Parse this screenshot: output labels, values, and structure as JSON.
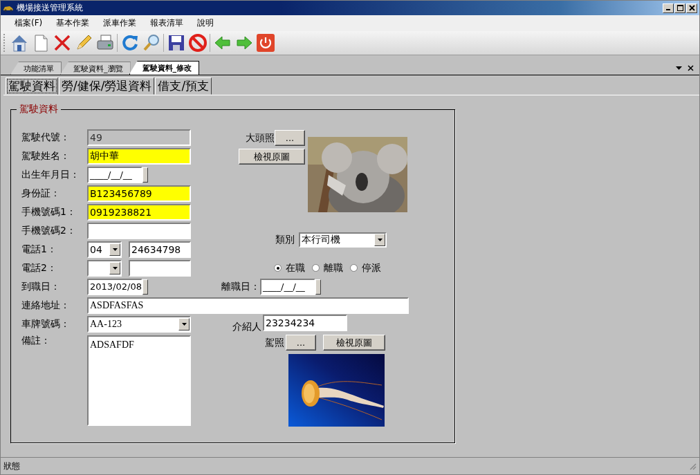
{
  "window": {
    "title": "機場接送管理系統"
  },
  "menu": [
    "檔案(F)",
    "基本作業",
    "派車作業",
    "報表清單",
    "說明"
  ],
  "doc_tabs": [
    {
      "label": "功能清單",
      "selected": false
    },
    {
      "label": "駕駛資料_瀏覽",
      "selected": false
    },
    {
      "label": "駕駛資料_修改",
      "selected": true
    }
  ],
  "sub_tabs": [
    {
      "label": "駕駛資料",
      "selected": true
    },
    {
      "label": "勞/健保/勞退資料",
      "selected": false
    },
    {
      "label": "借支/預支",
      "selected": false
    }
  ],
  "group": {
    "title": "駕駛資料"
  },
  "left_fields": [
    {
      "label": "駕駛代號：",
      "kind": "readonly",
      "value": "49"
    },
    {
      "label": "駕駛姓名：",
      "kind": "required",
      "value": "胡中華"
    },
    {
      "label": "出生年月日：",
      "kind": "date",
      "value": "____/__/__"
    },
    {
      "label": "身份証：",
      "kind": "required",
      "value": "B123456789"
    },
    {
      "label": "手機號碼1：",
      "kind": "required",
      "value": "0919238821"
    },
    {
      "label": "手機號碼2：",
      "kind": "text"
    },
    {
      "label": "電話1：",
      "kind": "phone",
      "area": "04",
      "number": "24634798"
    },
    {
      "label": "電話2：",
      "kind": "phone"
    },
    {
      "label": "到職日：",
      "kind": "date",
      "value": "2013/02/08"
    }
  ],
  "address": {
    "label": "連絡地址：",
    "value": "ASDFASFAS"
  },
  "plate": {
    "label": "車牌號碼：",
    "value": "AA-123"
  },
  "remark": {
    "label": "備註：",
    "value": "ADSAFDF"
  },
  "photo": {
    "label": "大頭照",
    "browse": "...",
    "view": "檢視原圖"
  },
  "category": {
    "label": "類別",
    "value": "本行司機"
  },
  "status_options": [
    {
      "label": "在職",
      "selected": true
    },
    {
      "label": "離職",
      "selected": false
    },
    {
      "label": "停派",
      "selected": false
    }
  ],
  "leave_date": {
    "label": "離職日：",
    "value": "____/__/__"
  },
  "referrer": {
    "label": "介紹人",
    "value": "23234234"
  },
  "license": {
    "label": "駕照",
    "browse": "...",
    "view": "檢視原圖"
  },
  "status_bar": "狀態"
}
